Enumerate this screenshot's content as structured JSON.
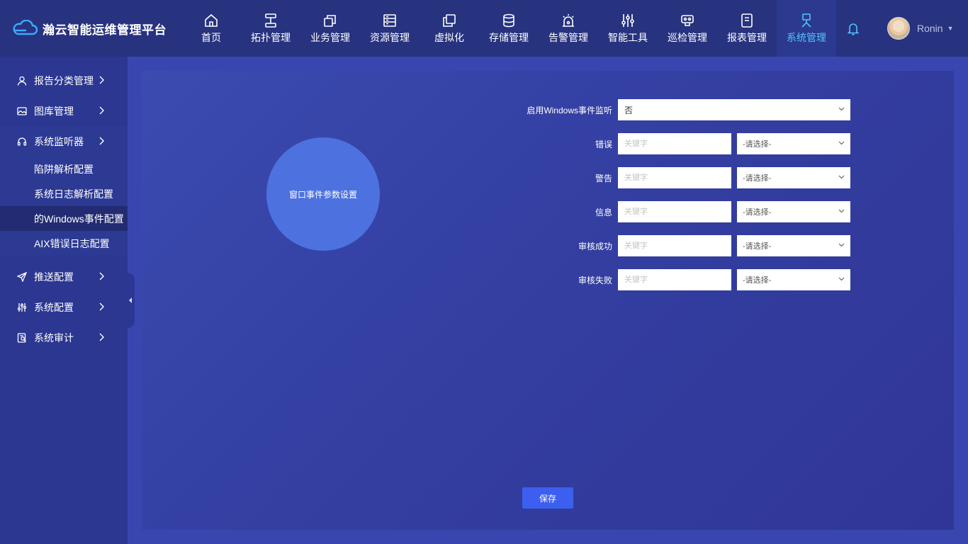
{
  "app": {
    "title": "瀚云智能运维管理平台"
  },
  "nav": [
    {
      "label": "首页",
      "icon": "home-icon"
    },
    {
      "label": "拓扑管理",
      "icon": "topology-icon"
    },
    {
      "label": "业务管理",
      "icon": "business-icon"
    },
    {
      "label": "资源管理",
      "icon": "resource-icon"
    },
    {
      "label": "虚拟化",
      "icon": "virtualization-icon"
    },
    {
      "label": "存储管理",
      "icon": "database-icon"
    },
    {
      "label": "告警管理",
      "icon": "alarm-icon"
    },
    {
      "label": "智能工具",
      "icon": "sliders-icon"
    },
    {
      "label": "巡检管理",
      "icon": "inspection-icon"
    },
    {
      "label": "报表管理",
      "icon": "report-icon"
    },
    {
      "label": "系统管理",
      "icon": "system-icon",
      "active": true
    }
  ],
  "user": {
    "name": "Ronin"
  },
  "sidebar": {
    "items": [
      {
        "label": "报告分类管理",
        "icon": "user-icon"
      },
      {
        "label": "图库管理",
        "icon": "image-icon"
      },
      {
        "label": "系统监听器",
        "icon": "headset-icon"
      },
      {
        "label": "推送配置",
        "icon": "send-icon"
      },
      {
        "label": "系统配置",
        "icon": "sliders-icon"
      },
      {
        "label": "系统审计",
        "icon": "audit-icon"
      }
    ],
    "subitems": [
      {
        "label": "陷阱解析配置"
      },
      {
        "label": "系统日志解析配置"
      },
      {
        "label": "的Windows事件配置",
        "active": true
      },
      {
        "label": "AIX错误日志配置"
      }
    ]
  },
  "main": {
    "circle_label": "窗口事件参数设置",
    "enable": {
      "label": "启用Windows事件监听",
      "value": "否"
    },
    "rows": [
      {
        "label": "错误",
        "placeholder": "关键字",
        "select": "-请选择-"
      },
      {
        "label": "警告",
        "placeholder": "关键字",
        "select": "-请选择-"
      },
      {
        "label": "信息",
        "placeholder": "关键字",
        "select": "-请选择-"
      },
      {
        "label": "审核成功",
        "placeholder": "关键字",
        "select": "-请选择-"
      },
      {
        "label": "审核失败",
        "placeholder": "关键字",
        "select": "-请选择-"
      }
    ],
    "save_label": "保存"
  },
  "colors": {
    "accent": "#4fc3ff",
    "button": "#3d5ff0",
    "circle": "#4d72e0"
  }
}
